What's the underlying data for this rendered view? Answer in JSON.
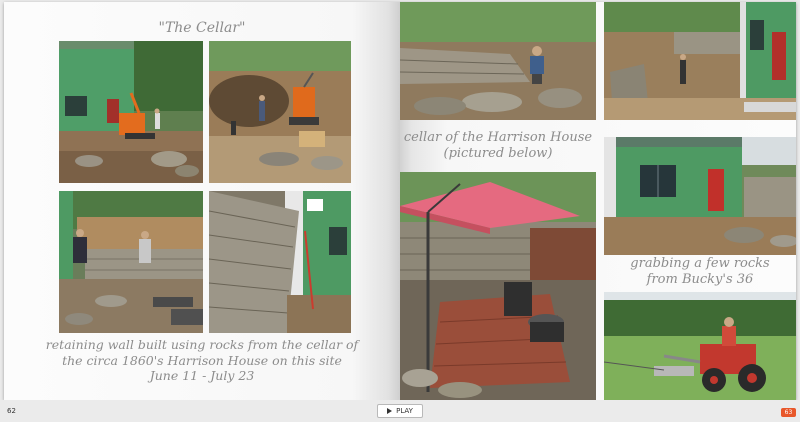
{
  "left_page": {
    "title": "\"The Cellar\"",
    "caption_line1": "retaining wall built using rocks from the cellar of",
    "caption_line2": "the circa 1860's Harrison House on this site",
    "caption_line3": "June 11 - July 23",
    "page_number": "62",
    "photos": [
      "house-excavator-photo",
      "excavation-site-photo",
      "wall-building-photo",
      "stone-wall-closeup-photo"
    ]
  },
  "right_page": {
    "caption_top_line1": "cellar of the Harrison House",
    "caption_top_line2": "(pictured below)",
    "caption_mid_line1": "grabbing a few rocks",
    "caption_mid_line2": "from Bucky's 36",
    "page_number": "63",
    "photos": [
      "man-on-rock-pile-photo",
      "house-corner-photo",
      "cellar-umbrella-photo",
      "house-window-photo",
      "tractor-photo"
    ]
  },
  "controls": {
    "play_label": "PLAY"
  },
  "colors": {
    "accent": "#e8572a",
    "caption": "#8c8c8c",
    "page": "#fbfbfb",
    "wrap": "#4e9a63",
    "dirt": "#8a6e4e",
    "stone": "#9c9688"
  }
}
